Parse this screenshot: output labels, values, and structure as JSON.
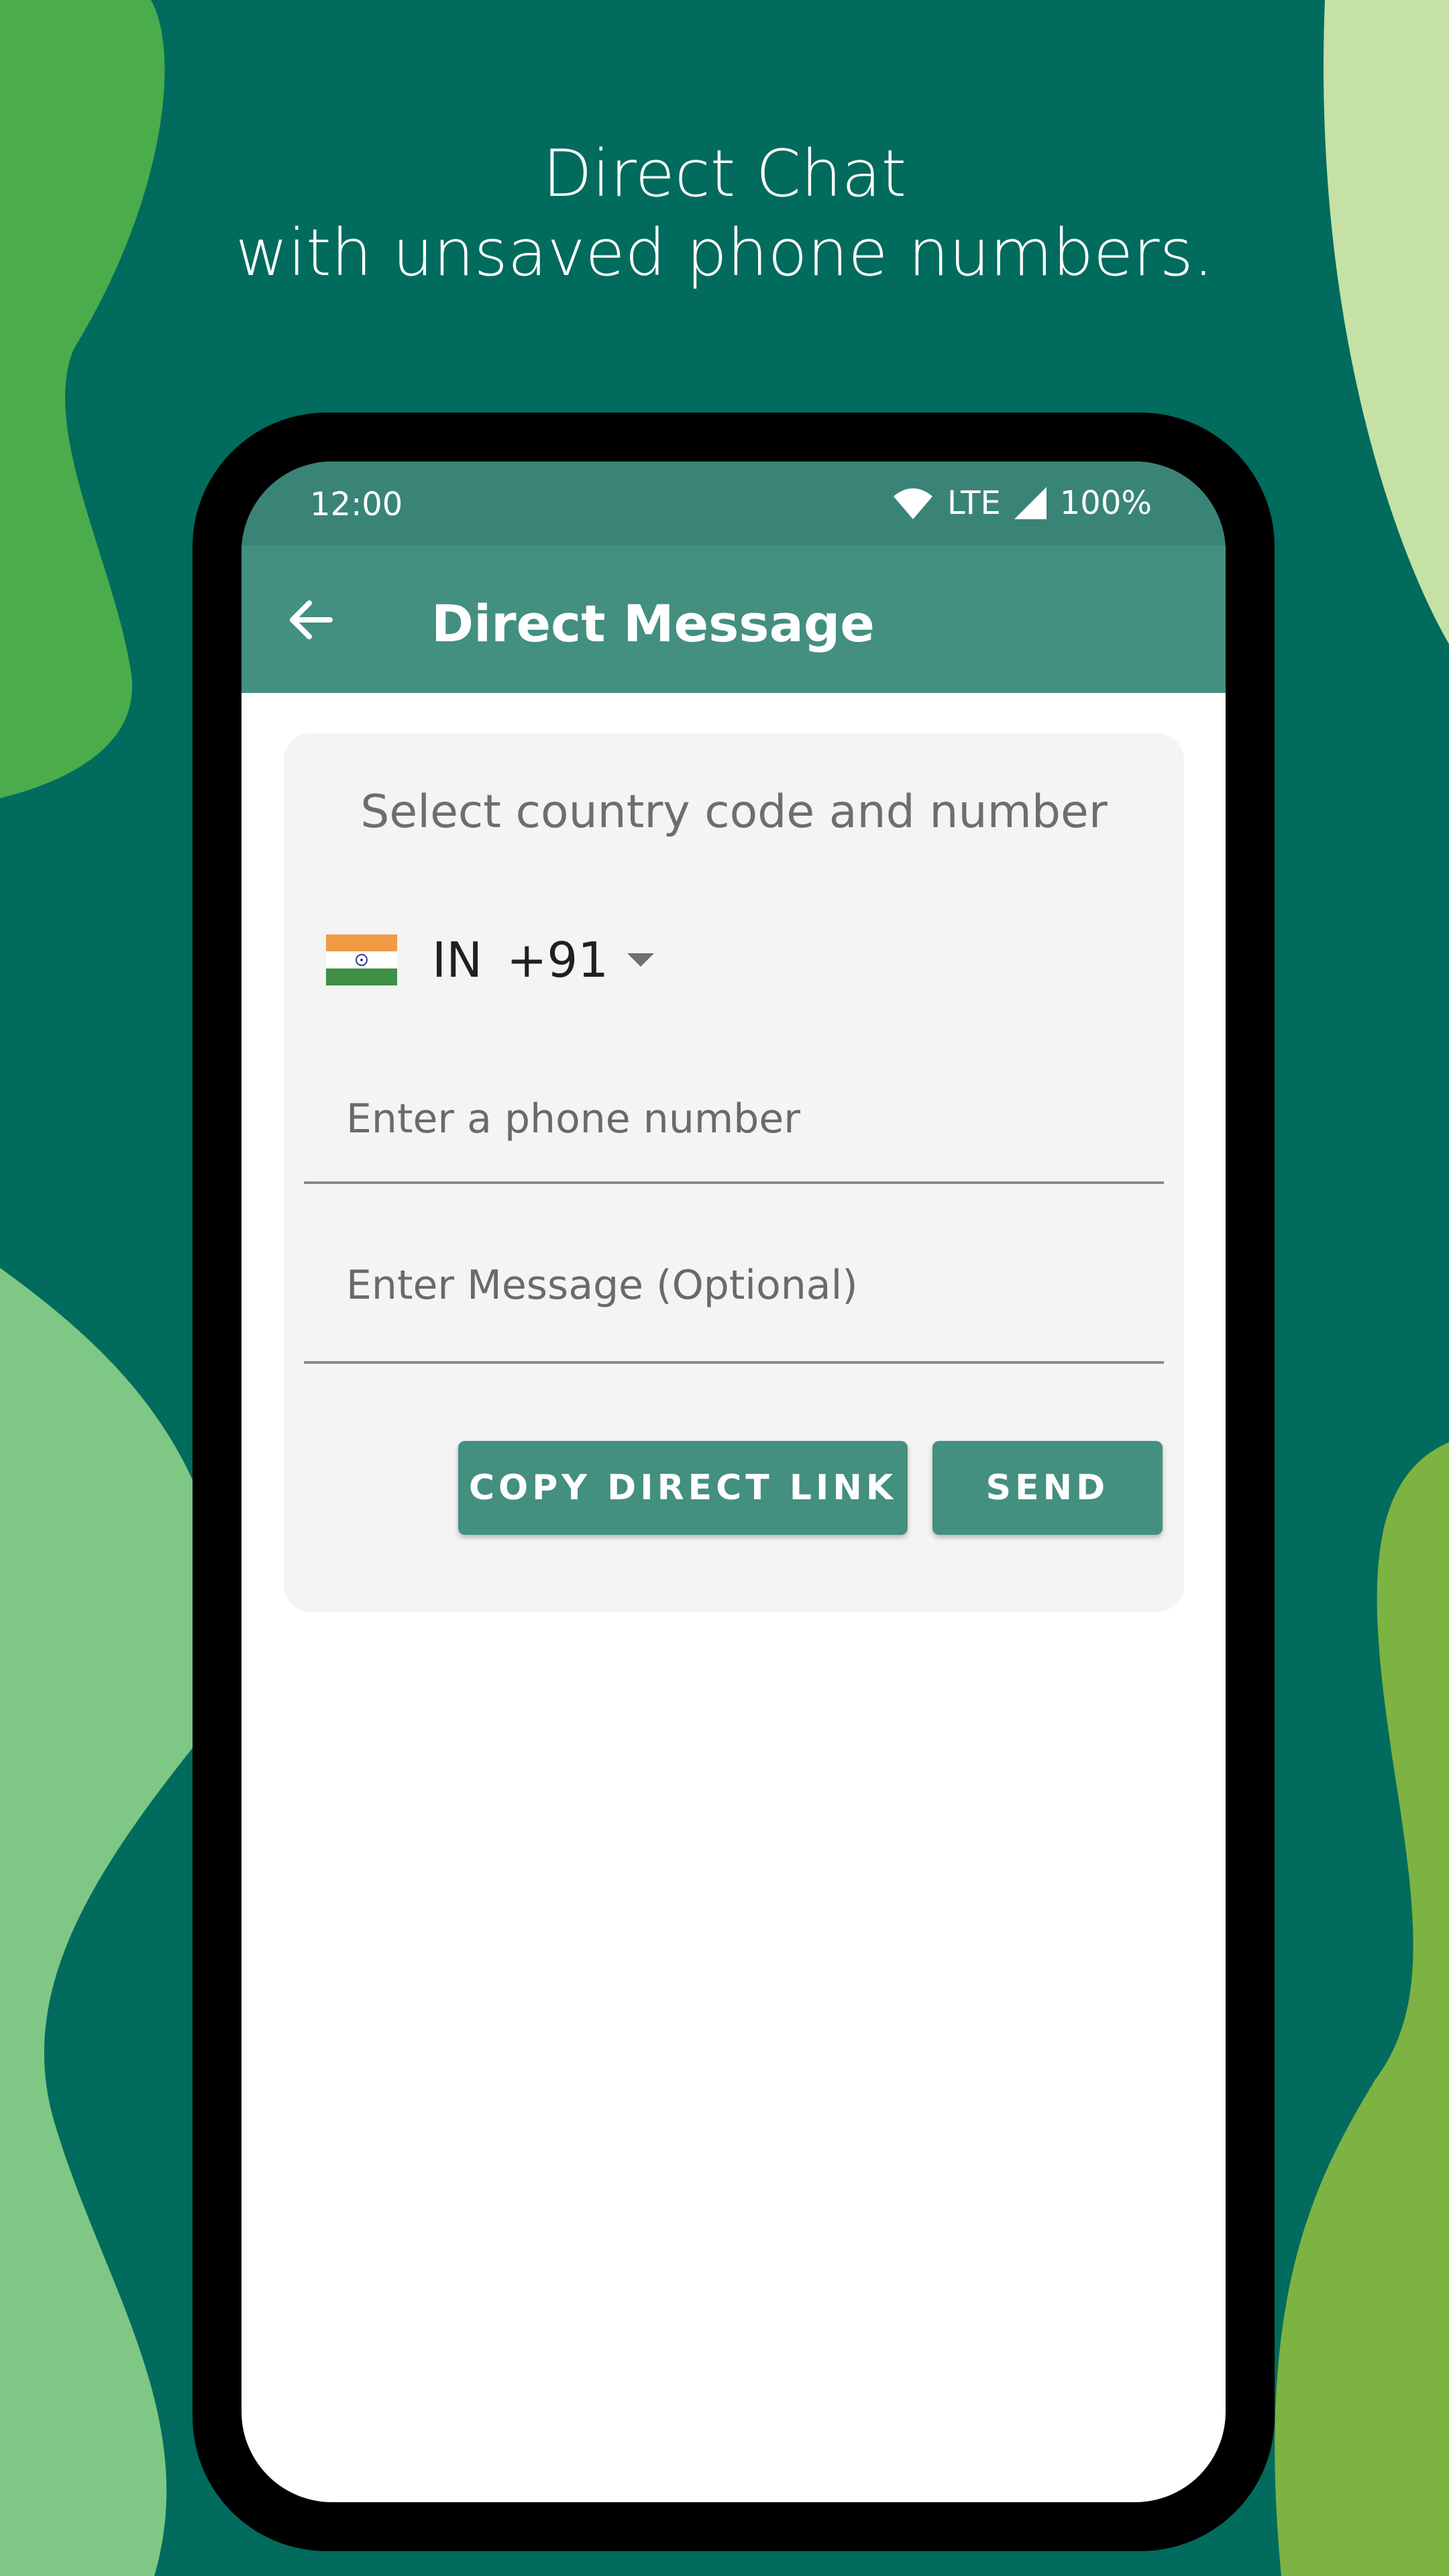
{
  "headline": {
    "line1": "Direct Chat",
    "line2": "with unsaved phone numbers."
  },
  "status_bar": {
    "time": "12:00",
    "network": "LTE",
    "battery": "100%",
    "icons": [
      "wifi-icon",
      "signal-icon"
    ]
  },
  "app_bar": {
    "title": "Direct Message",
    "back_icon": "arrow-left-icon"
  },
  "form": {
    "heading": "Select country code and number",
    "country": {
      "flag": "india-flag-icon",
      "code": "IN",
      "dial_code": "+91"
    },
    "phone_placeholder": "Enter a phone number",
    "message_placeholder": "Enter Message (Optional)",
    "copy_button": "COPY DIRECT LINK",
    "send_button": "SEND"
  },
  "colors": {
    "background": "#016b5d",
    "status_bar": "#3a8477",
    "app_bar": "#438f80",
    "button": "#438f80",
    "card": "#f4f4f4"
  }
}
